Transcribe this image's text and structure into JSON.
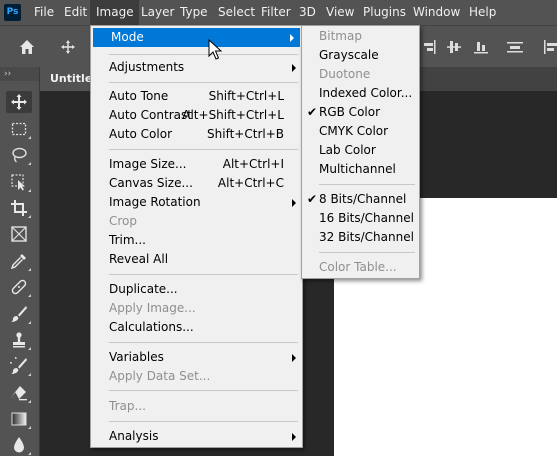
{
  "app": {
    "logo": "Ps",
    "accent": "#31a8ff"
  },
  "menubar": {
    "items": [
      {
        "label": "File"
      },
      {
        "label": "Edit"
      },
      {
        "label": "Image",
        "active": true
      },
      {
        "label": "Layer"
      },
      {
        "label": "Type"
      },
      {
        "label": "Select"
      },
      {
        "label": "Filter"
      },
      {
        "label": "3D"
      },
      {
        "label": "View"
      },
      {
        "label": "Plugins"
      },
      {
        "label": "Window"
      },
      {
        "label": "Help"
      }
    ]
  },
  "options_bar": {
    "icons": [
      "home-icon",
      "move-icon",
      "align-right-icon",
      "align-center-vertical-icon",
      "align-bottom-icon",
      "align-distribute-icon",
      "align-edge-icon"
    ]
  },
  "document": {
    "tab_label": "Untitled"
  },
  "toolbar": {
    "collapse_glyph": "››",
    "tools": [
      "move-tool",
      "marquee-tool",
      "lasso-tool",
      "object-selection-tool",
      "crop-tool",
      "frame-tool",
      "eyedropper-tool",
      "healing-brush-tool",
      "brush-tool",
      "stamp-tool",
      "history-brush-tool",
      "eraser-tool",
      "gradient-tool",
      "blur-tool"
    ]
  },
  "image_menu": {
    "highlight_color": "#0078d7",
    "items": [
      {
        "label": "Mode",
        "submenu": true,
        "highlighted": true
      },
      {
        "label": "Adjustments",
        "submenu": true
      },
      {
        "label": "Auto Tone",
        "shortcut": "Shift+Ctrl+L"
      },
      {
        "label": "Auto Contrast",
        "shortcut": "Alt+Shift+Ctrl+L"
      },
      {
        "label": "Auto Color",
        "shortcut": "Shift+Ctrl+B"
      },
      {
        "label": "Image Size...",
        "shortcut": "Alt+Ctrl+I"
      },
      {
        "label": "Canvas Size...",
        "shortcut": "Alt+Ctrl+C"
      },
      {
        "label": "Image Rotation",
        "submenu": true
      },
      {
        "label": "Crop",
        "disabled": true
      },
      {
        "label": "Trim..."
      },
      {
        "label": "Reveal All"
      },
      {
        "label": "Duplicate..."
      },
      {
        "label": "Apply Image...",
        "disabled": true
      },
      {
        "label": "Calculations..."
      },
      {
        "label": "Variables",
        "submenu": true
      },
      {
        "label": "Apply Data Set...",
        "disabled": true
      },
      {
        "label": "Trap...",
        "disabled": true
      },
      {
        "label": "Analysis",
        "submenu": true
      }
    ]
  },
  "mode_submenu": {
    "items": [
      {
        "label": "Bitmap",
        "disabled": true
      },
      {
        "label": "Grayscale"
      },
      {
        "label": "Duotone",
        "disabled": true
      },
      {
        "label": "Indexed Color..."
      },
      {
        "label": "RGB Color",
        "checked": true
      },
      {
        "label": "CMYK Color"
      },
      {
        "label": "Lab Color"
      },
      {
        "label": "Multichannel"
      },
      {
        "label": "8 Bits/Channel",
        "checked": true
      },
      {
        "label": "16 Bits/Channel"
      },
      {
        "label": "32 Bits/Channel"
      },
      {
        "label": "Color Table...",
        "disabled": true
      }
    ],
    "check_glyph": "✔"
  }
}
